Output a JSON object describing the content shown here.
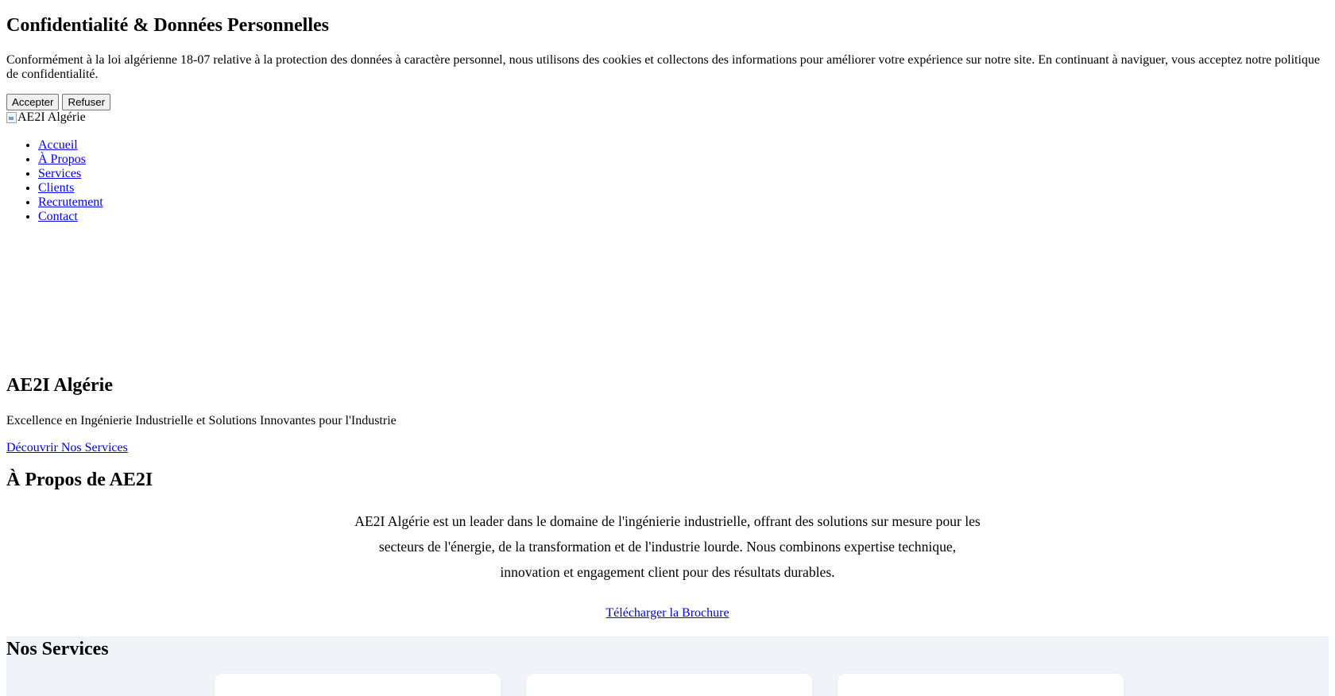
{
  "cookie_banner": {
    "title": "Confidentialité & Données Personnelles",
    "text": "Conformément à la loi algérienne 18-07 relative à la protection des données à caractère personnel, nous utilisons des cookies et collectons des informations pour améliorer votre expérience sur notre site. En continuant à naviguer, vous acceptez notre politique de confidentialité.",
    "accept_label": "Accepter",
    "refuse_label": "Refuser"
  },
  "header": {
    "logo_alt": "AE2I Algérie"
  },
  "nav": {
    "items": [
      {
        "label": "Accueil"
      },
      {
        "label": "À Propos"
      },
      {
        "label": "Services"
      },
      {
        "label": "Clients"
      },
      {
        "label": "Recrutement"
      },
      {
        "label": "Contact"
      }
    ]
  },
  "hero": {
    "title": "AE2I Algérie",
    "subtitle": "Excellence en Ingénierie Industrielle et Solutions Innovantes pour l'Industrie",
    "cta_label": "Découvrir Nos Services"
  },
  "about": {
    "title": "À Propos de AE2I",
    "text": "AE2I Algérie est un leader dans le domaine de l'ingénierie industrielle, offrant des solutions sur mesure pour les secteurs de l'énergie, de la transformation et de l'industrie lourde. Nous combinons expertise technique, innovation et engagement client pour des résultats durables.",
    "brochure_label": "Télécharger la Brochure"
  },
  "services": {
    "title": "Nos Services",
    "background_color": "#f0f3f7"
  },
  "colors": {
    "link": "#0000ee",
    "text": "#000000"
  }
}
